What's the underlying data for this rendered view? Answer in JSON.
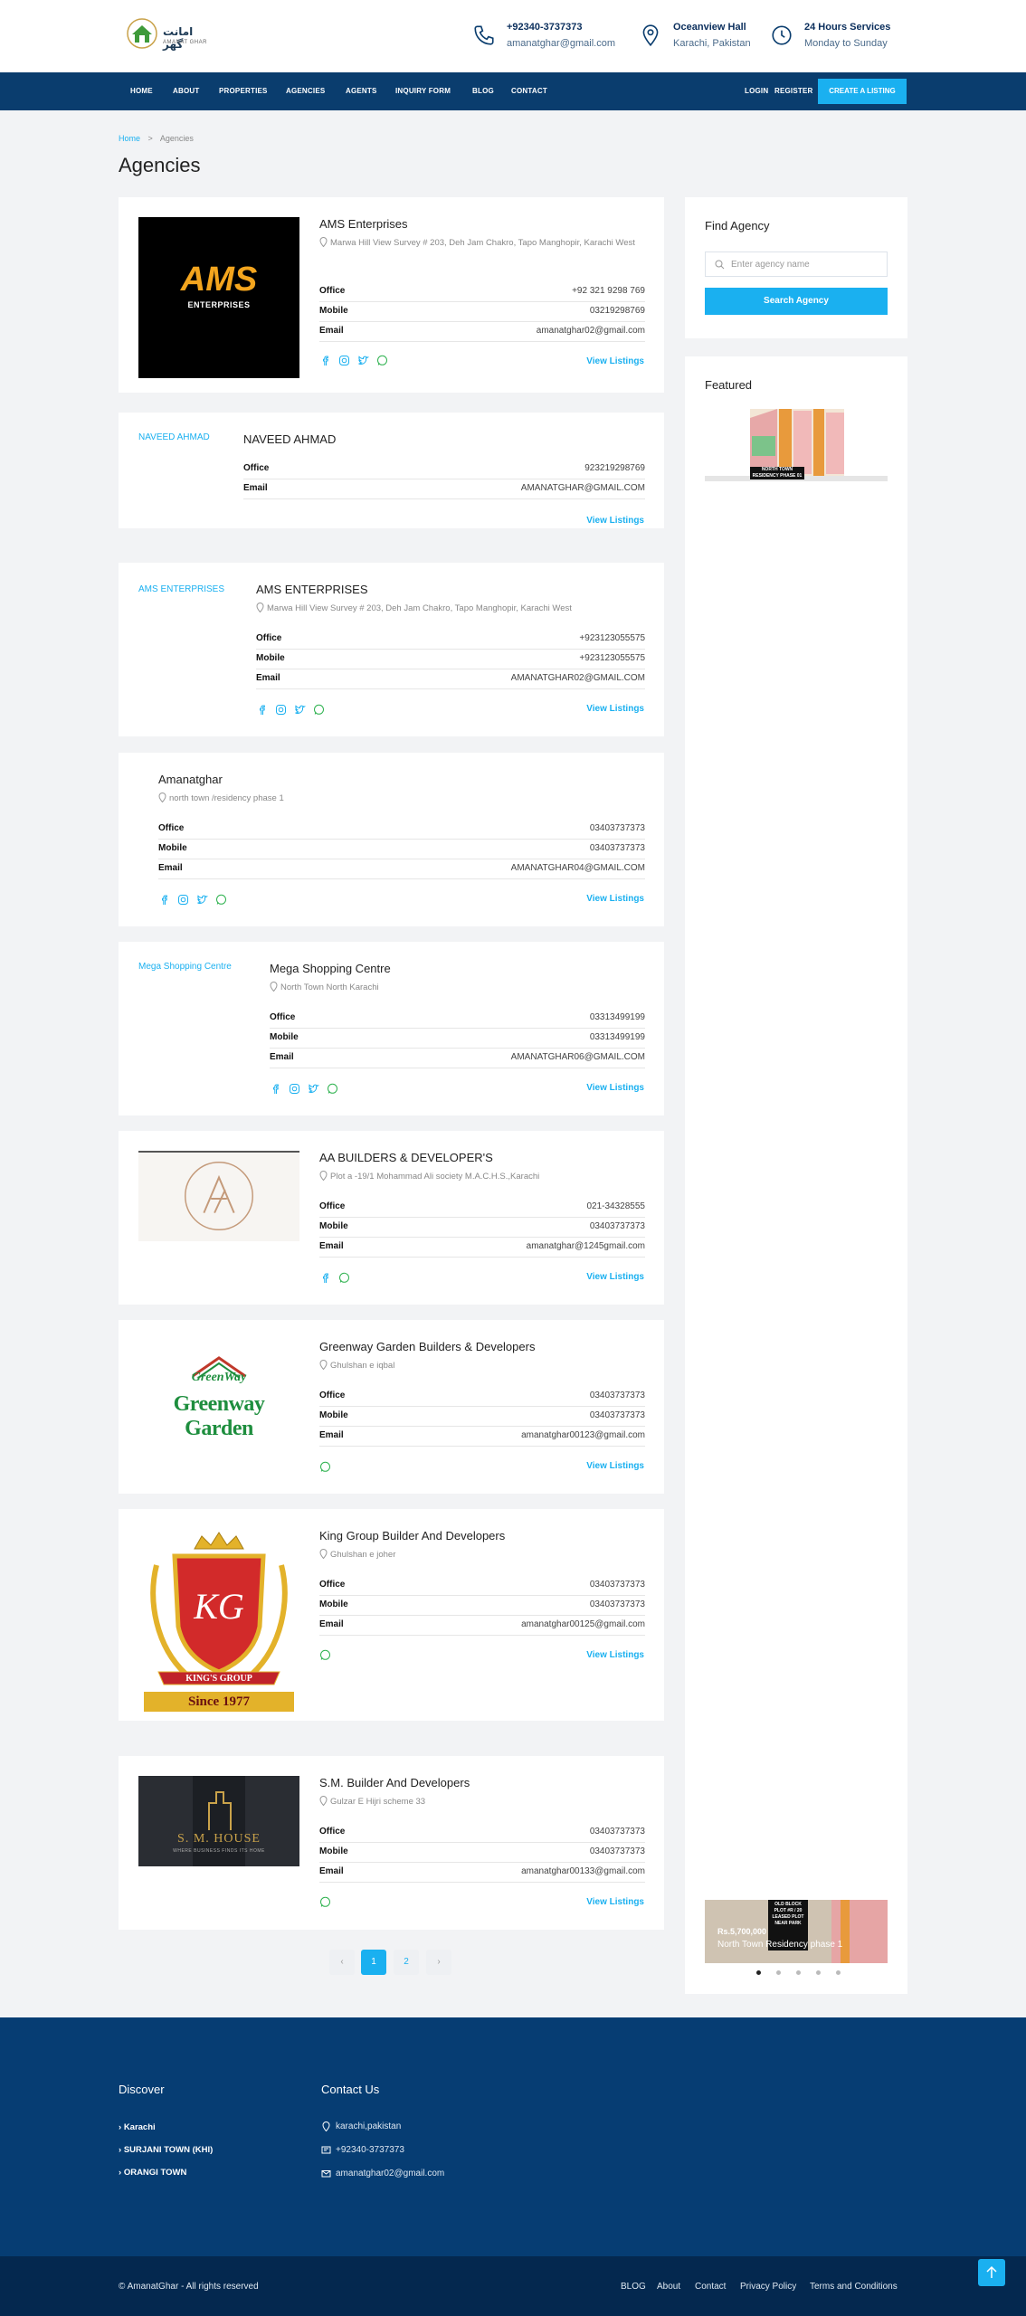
{
  "header": {
    "logo_text": "امانت گھر",
    "logo_sub": "AMANAT GHAR",
    "phone": "+92340-3737373",
    "email": "amanatghar@gmail.com",
    "location_title": "Oceanview Hall",
    "location_sub": "Karachi, Pakistan",
    "hours_title": "24 Hours Services",
    "hours_sub": "Monday to Sunday"
  },
  "nav": {
    "items": [
      "HOME",
      "ABOUT",
      "PROPERTIES",
      "AGENCIES",
      "AGENTS",
      "INQUIRY FORM",
      "BLOG",
      "CONTACT"
    ],
    "login": "LOGIN",
    "register": "REGISTER",
    "cta": "CREATE A LISTING"
  },
  "breadcrumb": {
    "home": "Home",
    "sep": ">",
    "current": "Agencies"
  },
  "page_title": "Agencies",
  "labels": {
    "office": "Office",
    "mobile": "Mobile",
    "email": "Email",
    "view_listings": "View Listings"
  },
  "agencies": [
    {
      "name": "AMS Enterprises",
      "address": "Marwa Hill View Survey # 203, Deh Jam Chakro, Tapo Manghopir, Karachi West",
      "office": "+92 321 9298 769",
      "mobile": "03219298769",
      "email": "amanatghar02@gmail.com",
      "logo_line1": "AMS",
      "logo_line2": "ENTERPRISES"
    },
    {
      "name": "NAVEED AHMAD",
      "image_alt": "NAVEED AHMAD",
      "office": "923219298769",
      "email": "AMANATGHAR@GMAIL.COM"
    },
    {
      "name": "AMS ENTERPRISES",
      "image_alt": "AMS ENTERPRISES",
      "address": "Marwa Hill View Survey # 203, Deh Jam Chakro, Tapo Manghopir, Karachi West",
      "office": "+923123055575",
      "mobile": "+923123055575",
      "email": "AMANATGHAR02@GMAIL.COM"
    },
    {
      "name": "Amanatghar",
      "address": "north town /residency phase 1",
      "office": "03403737373",
      "mobile": "03403737373",
      "email": "AMANATGHAR04@GMAIL.COM"
    },
    {
      "name": "Mega Shopping Centre",
      "image_alt": "Mega Shopping Centre",
      "address": "North Town North Karachi",
      "office": "03313499199",
      "mobile": "03313499199",
      "email": "AMANATGHAR06@GMAIL.COM"
    },
    {
      "name": "AA BUILDERS & DEVELOPER'S",
      "address": "Plot a -19/1 Mohammad Ali society M.A.C.H.S.,Karachi",
      "office": "021-34328555",
      "mobile": "03403737373",
      "email": "amanatghar@1245gmail.com"
    },
    {
      "name": "Greenway Garden Builders & Developers",
      "address": "Ghulshan e iqbal",
      "office": "03403737373",
      "mobile": "03403737373",
      "email": "amanatghar00123@gmail.com",
      "logo_small": "GreenWay",
      "logo_big": "Greenway Garden"
    },
    {
      "name": "King Group Builder And Developers",
      "address": "Ghulshan e joher",
      "office": "03403737373",
      "mobile": "03403737373",
      "email": "amanatghar00125@gmail.com",
      "logo_initials": "KG",
      "logo_banner": "KING'S GROUP",
      "logo_since": "Since 1977"
    },
    {
      "name": "S.M. Builder And Developers",
      "address": "Gulzar E Hijri scheme 33",
      "office": "03403737373",
      "mobile": "03403737373",
      "email": "amanatghar00133@gmail.com",
      "logo_text": "S. M. HOUSE",
      "logo_tag": "WHERE BUSINESS FINDS ITS HOME"
    }
  ],
  "sidebar": {
    "find_title": "Find Agency",
    "search_placeholder": "Enter agency name",
    "search_button": "Search Agency",
    "featured_title": "Featured",
    "featured_banner": "NORTH TOWN RESIDENCY PHASE 01",
    "slide_price": "Rs.5,700,000",
    "slide_title": "North Town Residency phase 1",
    "slide_sign": "OLD BLOCK PLOT #R / 20 LEASED PLOT NEAR PARK"
  },
  "pagination": {
    "prev": "‹",
    "pages": [
      "1",
      "2"
    ],
    "next": "›"
  },
  "footer": {
    "discover_title": "Discover",
    "discover_links": [
      "Karachi",
      "SURJANI TOWN (KHI)",
      "ORANGI TOWN"
    ],
    "contact_title": "Contact Us",
    "contact_address": "karachi,pakistan",
    "contact_phone": "+92340-3737373",
    "contact_email": "amanatghar02@gmail.com",
    "copyright": "© AmanatGhar - All rights reserved",
    "links": [
      "BLOG",
      "About",
      "Contact",
      "Privacy Policy",
      "Terms and Conditions"
    ]
  },
  "colors": {
    "accent": "#1ab0f0",
    "nav": "#0a3d6e",
    "footer": "#063d73",
    "footer_bottom": "#04284f"
  }
}
